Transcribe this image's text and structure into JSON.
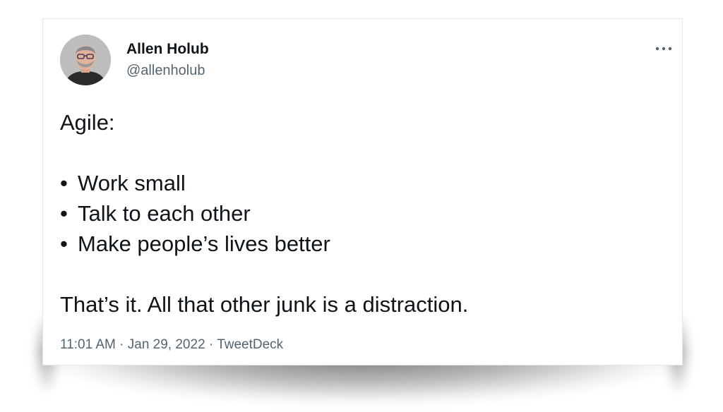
{
  "author": {
    "name": "Allen Holub",
    "handle": "@allenholub"
  },
  "more_icon": "more-horizontal-icon",
  "tweet": {
    "intro": "Agile:",
    "bullet_char": "•",
    "bullets": [
      "Work small",
      "Talk to each other",
      "Make people’s lives better"
    ],
    "closing": "That’s it. All that other junk is a distraction."
  },
  "meta": {
    "time": "11:01 AM",
    "separator": "·",
    "date": "Jan 29, 2022",
    "source": "TweetDeck"
  },
  "colors": {
    "text": "#0f1419",
    "secondary": "#536471"
  }
}
